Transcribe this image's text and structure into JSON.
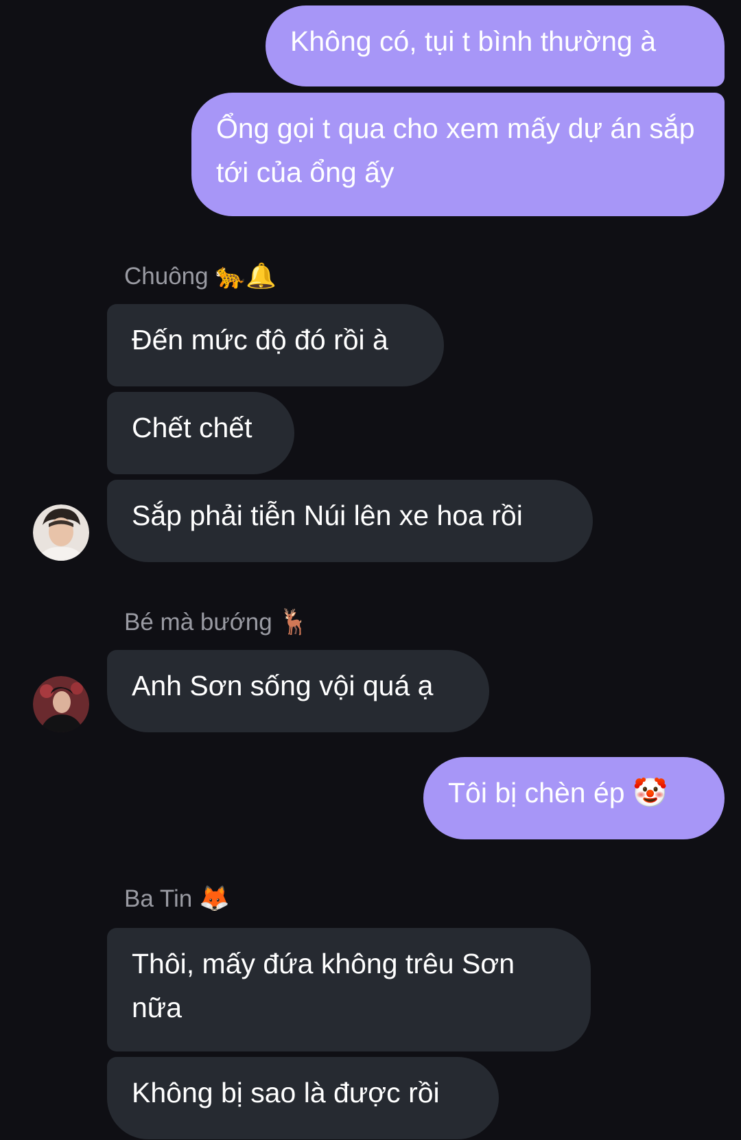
{
  "messages": {
    "out_1": "Không có, tụi t bình thường à",
    "out_2": "Ổng gọi t qua cho xem mấy dự án sắp tới của ổng ấy",
    "group_1": {
      "sender": "Chuông",
      "sender_emoji": "🐆🔔",
      "msg_1": "Đến mức độ đó rồi à",
      "msg_2": "Chết chết",
      "msg_3": "Sắp phải tiễn Núi lên xe hoa rồi"
    },
    "group_2": {
      "sender": "Bé mà bướng",
      "sender_emoji": "🦌",
      "msg_1": "Anh Sơn sống vội quá ạ"
    },
    "out_3": "Tôi bị chèn ép 🤡",
    "group_3": {
      "sender": "Ba Tin",
      "sender_emoji": "🦊",
      "msg_1": "Thôi, mấy đứa không trêu Sơn nữa",
      "msg_2": "Không bị sao là được rồi"
    }
  },
  "colors": {
    "background": "#0f0f14",
    "outgoing_bubble": "#a796f7",
    "incoming_bubble": "#262a31",
    "sender_name": "#9a9ba3"
  }
}
